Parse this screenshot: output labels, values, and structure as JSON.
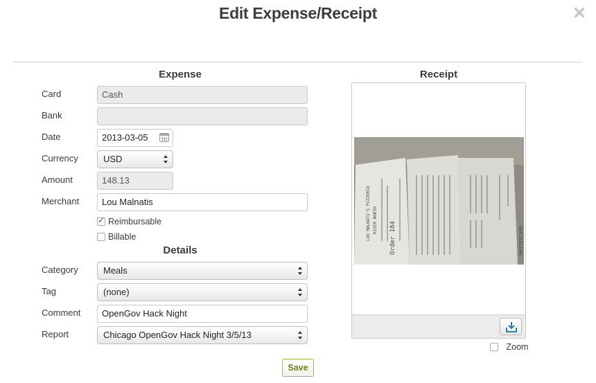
{
  "dialog": {
    "title": "Edit Expense/Receipt"
  },
  "expense": {
    "heading": "Expense",
    "card_label": "Card",
    "card_value": "Cash",
    "bank_label": "Bank",
    "bank_value": "",
    "date_label": "Date",
    "date_value": "2013-03-05",
    "currency_label": "Currency",
    "currency_value": "USD",
    "amount_label": "Amount",
    "amount_value": "148.13",
    "merchant_label": "Merchant",
    "merchant_value": "Lou Malnatis",
    "reimbursable_label": "Reimbursable",
    "reimbursable_checked": true,
    "billable_label": "Billable",
    "billable_checked": false
  },
  "details": {
    "heading": "Details",
    "category_label": "Category",
    "category_value": "Meals",
    "tag_label": "Tag",
    "tag_value": "(none)",
    "comment_label": "Comment",
    "comment_value": "OpenGov Hack Night",
    "report_label": "Report",
    "report_value": "Chicago OpenGov Hack Night 3/5/13"
  },
  "receipt": {
    "heading": "Receipt",
    "zoom_label": "Zoom",
    "zoom_checked": false,
    "download_icon": "download-icon",
    "image_text": {
      "merchant": "LOU MALNATI'S PIZZERIA",
      "location": "RIVER NORTH",
      "order": "Order 184",
      "card": "MASTERCARD"
    }
  },
  "actions": {
    "save_label": "Save"
  },
  "colors": {
    "save_border": "#a4b84a",
    "save_text": "#6b7f1e",
    "divider": "#cfcfcf"
  }
}
